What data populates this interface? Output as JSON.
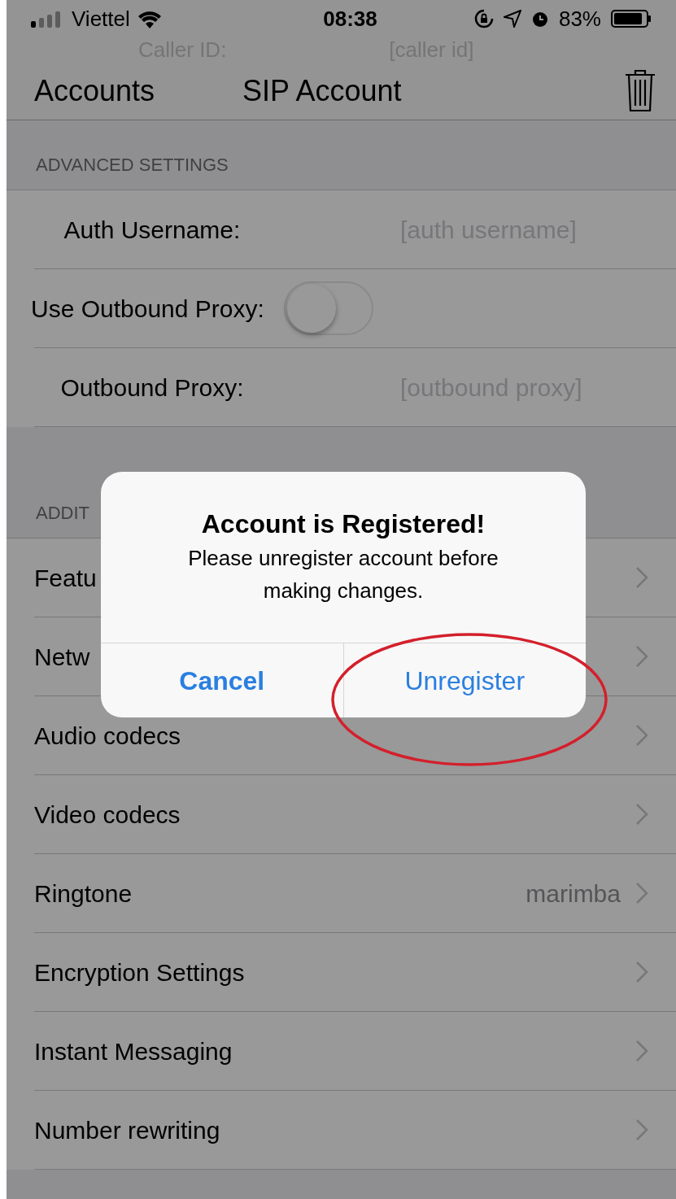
{
  "status_bar": {
    "carrier": "Viettel",
    "time": "08:38",
    "battery": "83%"
  },
  "behind_nav": {
    "label": "Caller ID:",
    "placeholder": "[caller id]"
  },
  "nav_bar": {
    "back": "Accounts",
    "title": "SIP Account"
  },
  "sections": [
    {
      "header": "ADVANCED SETTINGS",
      "rows": [
        {
          "kind": "field",
          "label": "Auth Username:",
          "placeholder": "[auth username]"
        },
        {
          "kind": "switch",
          "label": "Use Outbound Proxy:",
          "on": false
        },
        {
          "kind": "field",
          "label": "Outbound Proxy:",
          "placeholder": "[outbound proxy]"
        }
      ]
    },
    {
      "header": "ADDIT",
      "rows": [
        {
          "kind": "link",
          "label": "Featu"
        },
        {
          "kind": "link",
          "label": "Netw"
        },
        {
          "kind": "link",
          "label": "Audio codecs"
        },
        {
          "kind": "link",
          "label": "Video codecs"
        },
        {
          "kind": "link",
          "label": "Ringtone",
          "value": "marimba"
        },
        {
          "kind": "link",
          "label": "Encryption Settings"
        },
        {
          "kind": "link",
          "label": "Instant Messaging"
        },
        {
          "kind": "link",
          "label": "Number rewriting"
        }
      ]
    }
  ],
  "alert": {
    "title": "Account is Registered!",
    "message": "Please unregister account before making changes.",
    "buttons": [
      {
        "label": "Cancel",
        "bold": true
      },
      {
        "label": "Unregister",
        "bold": false
      }
    ]
  }
}
